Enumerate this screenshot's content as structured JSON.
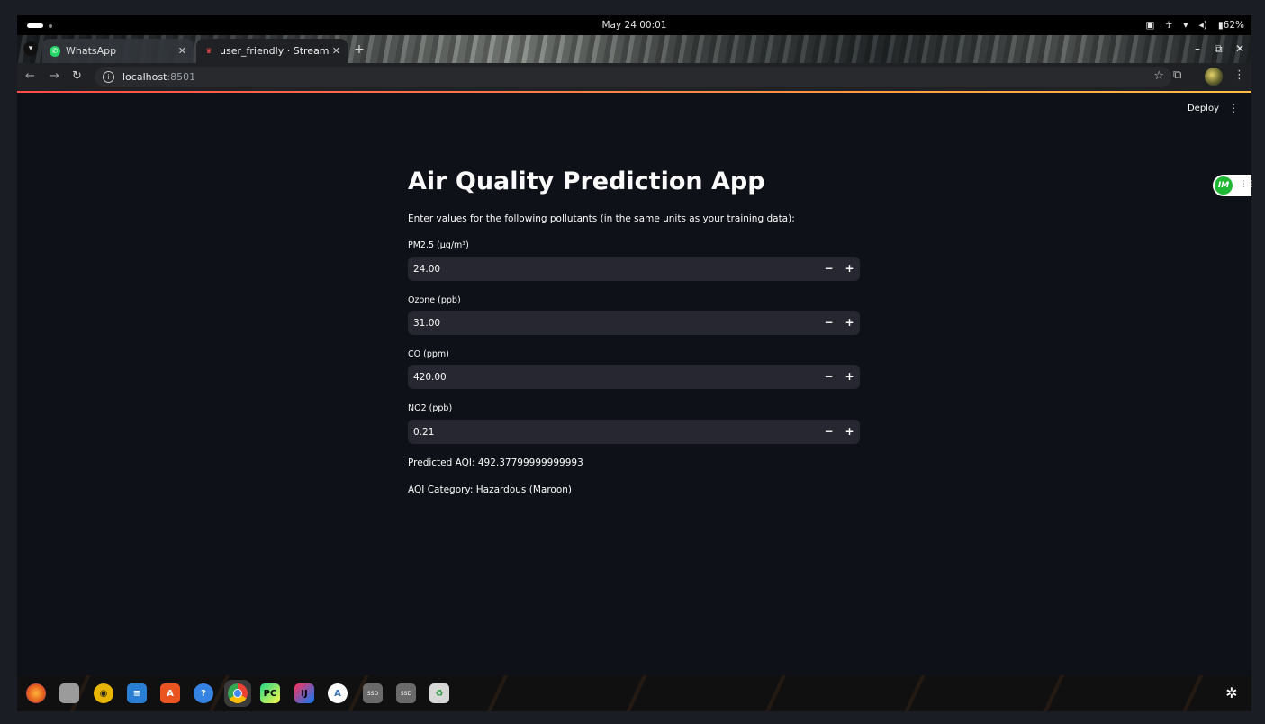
{
  "system": {
    "clock": "May 24  00:01",
    "battery": "62%"
  },
  "browser": {
    "tabs": [
      {
        "label": "WhatsApp",
        "icon": "whatsapp-icon",
        "color": "#25d366"
      },
      {
        "label": "user_friendly · Streamlit",
        "icon": "streamlit-icon",
        "color": "#ff4b4b"
      }
    ],
    "url": {
      "host": "localhost",
      "port": ":8501"
    }
  },
  "header": {
    "deploy_label": "Deploy"
  },
  "extension": {
    "label": "IM"
  },
  "main": {
    "title": "Air Quality Prediction App",
    "intro": "Enter values for the following pollutants (in the same units as your training data):",
    "fields": [
      {
        "label": "PM2.5 (µg/m³)",
        "value": "24.00"
      },
      {
        "label": "Ozone (ppb)",
        "value": "31.00"
      },
      {
        "label": "CO (ppm)",
        "value": "420.00"
      },
      {
        "label": "NO2 (ppb)",
        "value": "0.21"
      }
    ],
    "predicted": "Predicted AQI: 492.37799999999993",
    "category": "AQI Category: Hazardous (Maroon)"
  },
  "colors": {
    "app_bg": "#0e1117",
    "input_bg": "#262730",
    "accent": "#ff4b4b"
  },
  "dock": {
    "apps": [
      "firefox-icon",
      "files-icon",
      "rhythmbox-icon",
      "text-editor-icon",
      "app-store-icon",
      "help-icon",
      "chrome-icon",
      "pycharm-icon",
      "intellij-icon",
      "android-studio-icon",
      "disk-icon",
      "disk-icon",
      "trash-icon"
    ],
    "disk_label": "SSD"
  }
}
